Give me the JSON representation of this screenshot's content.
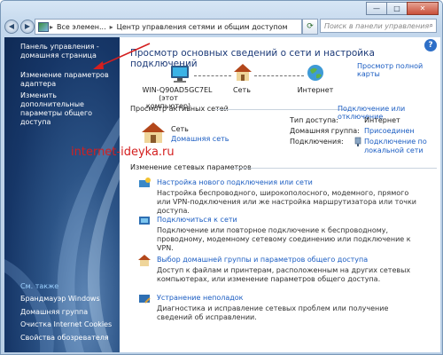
{
  "titlebar": {
    "minimize_glyph": "—",
    "maximize_glyph": "□",
    "close_glyph": "✕"
  },
  "address": {
    "segments": [
      "Все элемен...",
      "Центр управления сетями и общим доступом"
    ],
    "separator": "▸",
    "search_placeholder": "Поиск в панели управления"
  },
  "sidebar": {
    "items": [
      {
        "label": "Панель управления - домашняя страница"
      },
      {
        "label": "Изменение параметров адаптера"
      },
      {
        "label": "Изменить дополнительные параметры общего доступа"
      }
    ],
    "see_also_title": "См. также",
    "see_also": [
      {
        "label": "Брандмауэр Windows"
      },
      {
        "label": "Домашняя группа"
      },
      {
        "label": "Очистка Internet Cookies"
      },
      {
        "label": "Свойства обозревателя"
      }
    ]
  },
  "main": {
    "title": "Просмотр основных сведений о сети и настройка подключений",
    "full_map_link": "Просмотр полной карты",
    "map": {
      "computer_name": "WIN-Q90AD5GC7EL",
      "computer_sub": "(этот компьютер)",
      "network_label": "Сеть",
      "internet_label": "Интернет"
    },
    "active": {
      "section_title": "Просмотр активных сетей",
      "connect_link": "Подключение или отключение",
      "network_name": "Сеть",
      "network_type": "Домашняя сеть",
      "access_type_label": "Тип доступа:",
      "access_type_value": "Интернет",
      "homegroup_label": "Домашняя группа:",
      "homegroup_value": "Присоединен",
      "connections_label": "Подключения:",
      "connections_value": "Подключение по локальной сети"
    },
    "change": {
      "section_title": "Изменение сетевых параметров",
      "items": [
        {
          "title": "Настройка нового подключения или сети",
          "desc": "Настройка беспроводного, широкополосного, модемного, прямого или VPN-подключения или же настройка маршрутизатора или точки доступа."
        },
        {
          "title": "Подключиться к сети",
          "desc": "Подключение или повторное подключение к беспроводному, проводному, модемному сетевому соединению или подключение к VPN."
        },
        {
          "title": "Выбор домашней группы и параметров общего доступа",
          "desc": "Доступ к файлам и принтерам, расположенным на других сетевых компьютерах, или изменение параметров общего доступа."
        },
        {
          "title": "Устранение неполадок",
          "desc": "Диагностика и исправление сетевых проблем или получение сведений об исправлении."
        }
      ]
    }
  },
  "watermark": "internet-ideyka.ru",
  "colors": {
    "link": "#1a5cc2",
    "title": "#1c3a78",
    "sidebar_bg": "#163667",
    "watermark": "#d41f1f"
  }
}
